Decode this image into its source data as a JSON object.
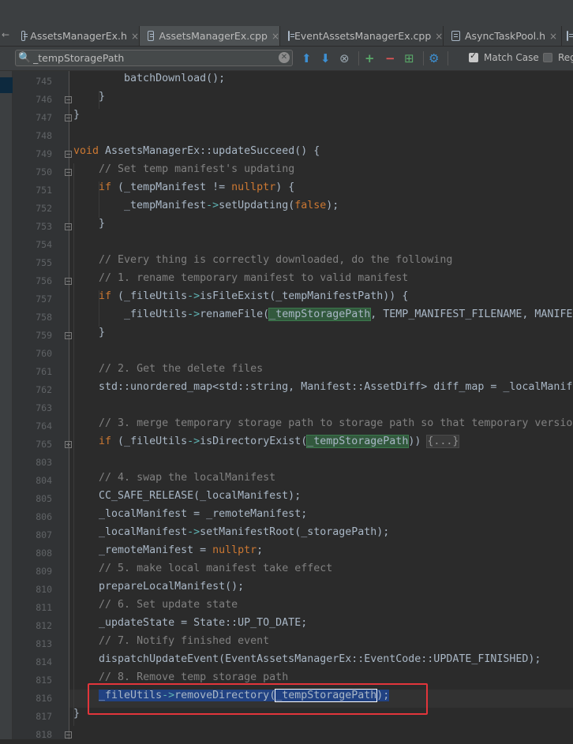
{
  "tabs": [
    {
      "label": "AssetsManagerEx.h",
      "closable": true,
      "active": false
    },
    {
      "label": "AssetsManagerEx.cpp",
      "closable": true,
      "active": true
    },
    {
      "label": "EventAssetsManagerEx.cpp",
      "closable": true,
      "active": false
    },
    {
      "label": "AsyncTaskPool.h",
      "closable": true,
      "active": false
    }
  ],
  "tab_scroll_glyph": "←",
  "tab_close_glyph": "×",
  "find": {
    "query": "_tempStoragePath",
    "match_case_label": "Match Case",
    "match_case_checked": true,
    "regex_label": "Regex",
    "regex_checked": false,
    "icons": [
      "search-icon",
      "clear-icon",
      "arrow-up-icon",
      "arrow-down-icon",
      "find-all-icon",
      "add-occurrence-icon",
      "remove-occurrence-icon",
      "select-all-occurrences-icon",
      "filter-icon"
    ]
  },
  "icons": {
    "search": "🔍",
    "clear": "✕",
    "up": "⬆",
    "down": "⬇",
    "findall": "⊗",
    "add": "+",
    "remove": "−",
    "selall": "⊞",
    "filter": "⚙"
  },
  "colors": {
    "background": "#2b2b2b",
    "keyword": "#cc7832",
    "comment": "#808080",
    "arrow": "#5fb3b3",
    "text": "#a9b7c6",
    "find_highlight": "#32593d",
    "selection": "#214283",
    "annotation_box": "#e2353b"
  },
  "lines": [
    {
      "num": "745",
      "segments": [
        {
          "t": "        batchDownload();"
        }
      ]
    },
    {
      "num": "746",
      "segments": [
        {
          "t": "    }"
        }
      ]
    },
    {
      "num": "747",
      "segments": [
        {
          "t": "}"
        }
      ]
    },
    {
      "num": "748",
      "segments": []
    },
    {
      "num": "749",
      "segments": [
        {
          "t": "void",
          "c": "kw"
        },
        {
          "t": " AssetsManagerEx::updateSucceed() {"
        }
      ]
    },
    {
      "num": "750",
      "segments": [
        {
          "t": "    "
        },
        {
          "t": "// Set temp manifest's updating",
          "c": "cm"
        }
      ]
    },
    {
      "num": "751",
      "segments": [
        {
          "t": "    "
        },
        {
          "t": "if",
          "c": "kw"
        },
        {
          "t": " (_tempManifest != "
        },
        {
          "t": "nullptr",
          "c": "kw"
        },
        {
          "t": ") {"
        }
      ]
    },
    {
      "num": "752",
      "segments": [
        {
          "t": "        _tempManifest"
        },
        {
          "t": "->",
          "c": "ar"
        },
        {
          "t": "setUpdating("
        },
        {
          "t": "false",
          "c": "kw"
        },
        {
          "t": ");"
        }
      ]
    },
    {
      "num": "753",
      "segments": [
        {
          "t": "    }"
        }
      ]
    },
    {
      "num": "754",
      "segments": []
    },
    {
      "num": "755",
      "segments": [
        {
          "t": "    "
        },
        {
          "t": "// Every thing is correctly downloaded, do the following",
          "c": "cm"
        }
      ]
    },
    {
      "num": "756",
      "segments": [
        {
          "t": "    "
        },
        {
          "t": "// 1. rename temporary manifest to valid manifest",
          "c": "cm"
        }
      ]
    },
    {
      "num": "757",
      "segments": [
        {
          "t": "    "
        },
        {
          "t": "if",
          "c": "kw"
        },
        {
          "t": " (_fileUtils"
        },
        {
          "t": "->",
          "c": "ar"
        },
        {
          "t": "isFileExist(_tempManifestPath)) {"
        }
      ]
    },
    {
      "num": "758",
      "segments": [
        {
          "t": "        _fileUtils"
        },
        {
          "t": "->",
          "c": "ar"
        },
        {
          "t": "renameFile("
        },
        {
          "t": "_tempStoragePath",
          "c": "find"
        },
        {
          "t": ", TEMP_MANIFEST_FILENAME, MANIFE"
        }
      ]
    },
    {
      "num": "759",
      "segments": [
        {
          "t": "    }"
        }
      ]
    },
    {
      "num": "760",
      "segments": []
    },
    {
      "num": "761",
      "segments": [
        {
          "t": "    "
        },
        {
          "t": "// 2. Get the delete files",
          "c": "cm"
        }
      ]
    },
    {
      "num": "762",
      "segments": [
        {
          "t": "    std::unordered_map<std::string, Manifest::AssetDiff> diff_map = _localManif"
        }
      ]
    },
    {
      "num": "763",
      "segments": []
    },
    {
      "num": "764",
      "segments": [
        {
          "t": "    "
        },
        {
          "t": "// 3. merge temporary storage path to storage path so that temporary versio",
          "c": "cm"
        }
      ]
    },
    {
      "num": "765",
      "segments": [
        {
          "t": "    "
        },
        {
          "t": "if",
          "c": "kw"
        },
        {
          "t": " (_fileUtils"
        },
        {
          "t": "->",
          "c": "ar"
        },
        {
          "t": "isDirectoryExist("
        },
        {
          "t": "_tempStoragePath",
          "c": "find"
        },
        {
          "t": ")) "
        },
        {
          "t": "{...}",
          "c": "fold"
        }
      ]
    },
    {
      "num": "803",
      "segments": []
    },
    {
      "num": "804",
      "segments": [
        {
          "t": "    "
        },
        {
          "t": "// 4. swap the localManifest",
          "c": "cm"
        }
      ]
    },
    {
      "num": "805",
      "segments": [
        {
          "t": "    CC_SAFE_RELEASE(_localManifest);"
        }
      ]
    },
    {
      "num": "806",
      "segments": [
        {
          "t": "    _localManifest = _remoteManifest;"
        }
      ]
    },
    {
      "num": "807",
      "segments": [
        {
          "t": "    _localManifest"
        },
        {
          "t": "->",
          "c": "ar"
        },
        {
          "t": "setManifestRoot(_storagePath);"
        }
      ]
    },
    {
      "num": "808",
      "segments": [
        {
          "t": "    _remoteManifest = "
        },
        {
          "t": "nullptr",
          "c": "kw"
        },
        {
          "t": ";"
        }
      ]
    },
    {
      "num": "809",
      "segments": [
        {
          "t": "    "
        },
        {
          "t": "// 5. make local manifest take effect",
          "c": "cm"
        }
      ]
    },
    {
      "num": "810",
      "segments": [
        {
          "t": "    prepareLocalManifest();"
        }
      ]
    },
    {
      "num": "811",
      "segments": [
        {
          "t": "    "
        },
        {
          "t": "// 6. Set update state",
          "c": "cm"
        }
      ]
    },
    {
      "num": "812",
      "segments": [
        {
          "t": "    _updateState = State::UP_TO_DATE;"
        }
      ]
    },
    {
      "num": "813",
      "segments": [
        {
          "t": "    "
        },
        {
          "t": "// 7. Notify finished event",
          "c": "cm"
        }
      ]
    },
    {
      "num": "814",
      "segments": [
        {
          "t": "    dispatchUpdateEvent(EventAssetsManagerEx::EventCode::UPDATE_FINISHED);"
        }
      ]
    },
    {
      "num": "815",
      "segments": [
        {
          "t": "    "
        },
        {
          "t": "// 8. Remove temp storage path",
          "c": "cm"
        }
      ]
    },
    {
      "num": "816",
      "segments": [
        {
          "t": "    "
        },
        {
          "t": "_fileUtils",
          "c": "sel"
        },
        {
          "t": "->",
          "c": "selar"
        },
        {
          "t": "removeDirectory(",
          "c": "sel"
        },
        {
          "t": "_tempStoragePath",
          "c": "cur"
        },
        {
          "t": ");",
          "c": "sel"
        }
      ]
    },
    {
      "num": "817",
      "segments": [
        {
          "t": "}"
        }
      ]
    },
    {
      "num": "818",
      "segments": []
    }
  ]
}
